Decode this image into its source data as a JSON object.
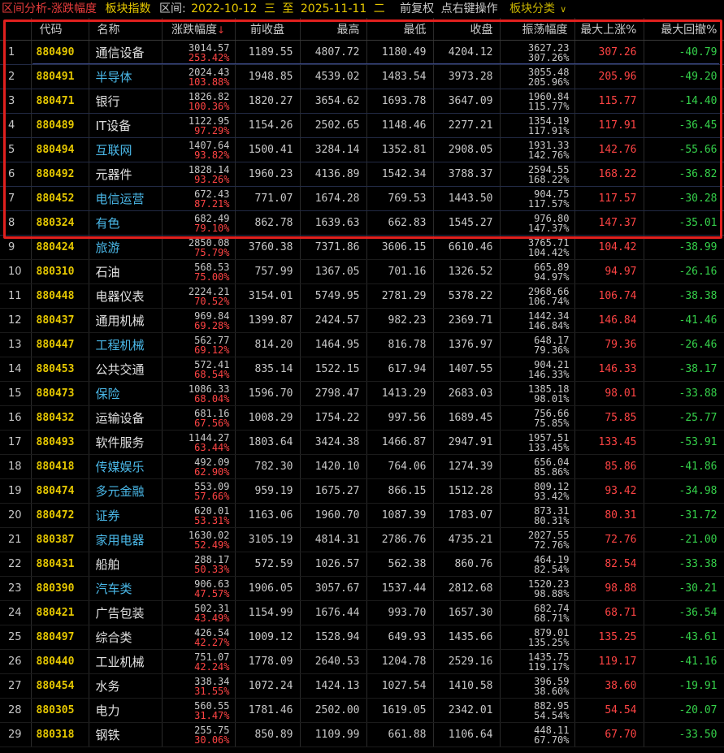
{
  "title": {
    "part1": "区间分析",
    "part2": "-涨跌幅度",
    "part3": "板块指数",
    "range_label": "区间:",
    "start_date": "2022-10-12",
    "start_weekday": "三",
    "to": "至",
    "end_date": "2025-11-11",
    "end_weekday": "二",
    "adjust": "前复权",
    "hint": "点右键操作",
    "category": "板块分类",
    "category_arrow": "∨"
  },
  "headers": {
    "idx": "",
    "code": "代码",
    "name": "名称",
    "change": "涨跌幅度",
    "sort_arrow": "↓",
    "prev_close": "前收盘",
    "high": "最高",
    "low": "最低",
    "close": "收盘",
    "amplitude": "振荡幅度",
    "max_up": "最大上涨%",
    "max_drawdown": "最大回撤%"
  },
  "rows": [
    {
      "idx": "1",
      "code": "880490",
      "name": "通信设备",
      "name_color": "white",
      "chg_abs": "3014.57",
      "chg_pct": "253.42%",
      "prev": "1189.55",
      "high": "4807.72",
      "low": "1180.49",
      "close": "4204.12",
      "amp_abs": "3627.23",
      "amp_pct": "307.26%",
      "max_up": "307.26",
      "max_dd": "-40.79"
    },
    {
      "idx": "2",
      "code": "880491",
      "name": "半导体",
      "name_color": "cyan",
      "chg_abs": "2024.43",
      "chg_pct": "103.88%",
      "prev": "1948.85",
      "high": "4539.02",
      "low": "1483.54",
      "close": "3973.28",
      "amp_abs": "3055.48",
      "amp_pct": "205.96%",
      "max_up": "205.96",
      "max_dd": "-49.20"
    },
    {
      "idx": "3",
      "code": "880471",
      "name": "银行",
      "name_color": "white",
      "chg_abs": "1826.82",
      "chg_pct": "100.36%",
      "prev": "1820.27",
      "high": "3654.62",
      "low": "1693.78",
      "close": "3647.09",
      "amp_abs": "1960.84",
      "amp_pct": "115.77%",
      "max_up": "115.77",
      "max_dd": "-14.40"
    },
    {
      "idx": "4",
      "code": "880489",
      "name": "IT设备",
      "name_color": "white",
      "chg_abs": "1122.95",
      "chg_pct": "97.29%",
      "prev": "1154.26",
      "high": "2502.65",
      "low": "1148.46",
      "close": "2277.21",
      "amp_abs": "1354.19",
      "amp_pct": "117.91%",
      "max_up": "117.91",
      "max_dd": "-36.45"
    },
    {
      "idx": "5",
      "code": "880494",
      "name": "互联网",
      "name_color": "cyan",
      "chg_abs": "1407.64",
      "chg_pct": "93.82%",
      "prev": "1500.41",
      "high": "3284.14",
      "low": "1352.81",
      "close": "2908.05",
      "amp_abs": "1931.33",
      "amp_pct": "142.76%",
      "max_up": "142.76",
      "max_dd": "-55.66"
    },
    {
      "idx": "6",
      "code": "880492",
      "name": "元器件",
      "name_color": "white",
      "chg_abs": "1828.14",
      "chg_pct": "93.26%",
      "prev": "1960.23",
      "high": "4136.89",
      "low": "1542.34",
      "close": "3788.37",
      "amp_abs": "2594.55",
      "amp_pct": "168.22%",
      "max_up": "168.22",
      "max_dd": "-36.82"
    },
    {
      "idx": "7",
      "code": "880452",
      "name": "电信运营",
      "name_color": "cyan",
      "chg_abs": "672.43",
      "chg_pct": "87.21%",
      "prev": "771.07",
      "high": "1674.28",
      "low": "769.53",
      "close": "1443.50",
      "amp_abs": "904.75",
      "amp_pct": "117.57%",
      "max_up": "117.57",
      "max_dd": "-30.28"
    },
    {
      "idx": "8",
      "code": "880324",
      "name": "有色",
      "name_color": "cyan",
      "chg_abs": "682.49",
      "chg_pct": "79.10%",
      "prev": "862.78",
      "high": "1639.63",
      "low": "662.83",
      "close": "1545.27",
      "amp_abs": "976.80",
      "amp_pct": "147.37%",
      "max_up": "147.37",
      "max_dd": "-35.01"
    },
    {
      "idx": "9",
      "code": "880424",
      "name": "旅游",
      "name_color": "cyan",
      "chg_abs": "2850.08",
      "chg_pct": "75.79%",
      "prev": "3760.38",
      "high": "7371.86",
      "low": "3606.15",
      "close": "6610.46",
      "amp_abs": "3765.71",
      "amp_pct": "104.42%",
      "max_up": "104.42",
      "max_dd": "-38.99"
    },
    {
      "idx": "10",
      "code": "880310",
      "name": "石油",
      "name_color": "white",
      "chg_abs": "568.53",
      "chg_pct": "75.00%",
      "prev": "757.99",
      "high": "1367.05",
      "low": "701.16",
      "close": "1326.52",
      "amp_abs": "665.89",
      "amp_pct": "94.97%",
      "max_up": "94.97",
      "max_dd": "-26.16"
    },
    {
      "idx": "11",
      "code": "880448",
      "name": "电器仪表",
      "name_color": "white",
      "chg_abs": "2224.21",
      "chg_pct": "70.52%",
      "prev": "3154.01",
      "high": "5749.95",
      "low": "2781.29",
      "close": "5378.22",
      "amp_abs": "2968.66",
      "amp_pct": "106.74%",
      "max_up": "106.74",
      "max_dd": "-38.38"
    },
    {
      "idx": "12",
      "code": "880437",
      "name": "通用机械",
      "name_color": "white",
      "chg_abs": "969.84",
      "chg_pct": "69.28%",
      "prev": "1399.87",
      "high": "2424.57",
      "low": "982.23",
      "close": "2369.71",
      "amp_abs": "1442.34",
      "amp_pct": "146.84%",
      "max_up": "146.84",
      "max_dd": "-41.46"
    },
    {
      "idx": "13",
      "code": "880447",
      "name": "工程机械",
      "name_color": "cyan",
      "chg_abs": "562.77",
      "chg_pct": "69.12%",
      "prev": "814.20",
      "high": "1464.95",
      "low": "816.78",
      "close": "1376.97",
      "amp_abs": "648.17",
      "amp_pct": "79.36%",
      "max_up": "79.36",
      "max_dd": "-26.46"
    },
    {
      "idx": "14",
      "code": "880453",
      "name": "公共交通",
      "name_color": "white",
      "chg_abs": "572.41",
      "chg_pct": "68.54%",
      "prev": "835.14",
      "high": "1522.15",
      "low": "617.94",
      "close": "1407.55",
      "amp_abs": "904.21",
      "amp_pct": "146.33%",
      "max_up": "146.33",
      "max_dd": "-38.17"
    },
    {
      "idx": "15",
      "code": "880473",
      "name": "保险",
      "name_color": "cyan",
      "chg_abs": "1086.33",
      "chg_pct": "68.04%",
      "prev": "1596.70",
      "high": "2798.47",
      "low": "1413.29",
      "close": "2683.03",
      "amp_abs": "1385.18",
      "amp_pct": "98.01%",
      "max_up": "98.01",
      "max_dd": "-33.88"
    },
    {
      "idx": "16",
      "code": "880432",
      "name": "运输设备",
      "name_color": "white",
      "chg_abs": "681.16",
      "chg_pct": "67.56%",
      "prev": "1008.29",
      "high": "1754.22",
      "low": "997.56",
      "close": "1689.45",
      "amp_abs": "756.66",
      "amp_pct": "75.85%",
      "max_up": "75.85",
      "max_dd": "-25.77"
    },
    {
      "idx": "17",
      "code": "880493",
      "name": "软件服务",
      "name_color": "white",
      "chg_abs": "1144.27",
      "chg_pct": "63.44%",
      "prev": "1803.64",
      "high": "3424.38",
      "low": "1466.87",
      "close": "2947.91",
      "amp_abs": "1957.51",
      "amp_pct": "133.45%",
      "max_up": "133.45",
      "max_dd": "-53.91"
    },
    {
      "idx": "18",
      "code": "880418",
      "name": "传媒娱乐",
      "name_color": "cyan",
      "chg_abs": "492.09",
      "chg_pct": "62.90%",
      "prev": "782.30",
      "high": "1420.10",
      "low": "764.06",
      "close": "1274.39",
      "amp_abs": "656.04",
      "amp_pct": "85.86%",
      "max_up": "85.86",
      "max_dd": "-41.86"
    },
    {
      "idx": "19",
      "code": "880474",
      "name": "多元金融",
      "name_color": "cyan",
      "chg_abs": "553.09",
      "chg_pct": "57.66%",
      "prev": "959.19",
      "high": "1675.27",
      "low": "866.15",
      "close": "1512.28",
      "amp_abs": "809.12",
      "amp_pct": "93.42%",
      "max_up": "93.42",
      "max_dd": "-34.98"
    },
    {
      "idx": "20",
      "code": "880472",
      "name": "证券",
      "name_color": "cyan",
      "chg_abs": "620.01",
      "chg_pct": "53.31%",
      "prev": "1163.06",
      "high": "1960.70",
      "low": "1087.39",
      "close": "1783.07",
      "amp_abs": "873.31",
      "amp_pct": "80.31%",
      "max_up": "80.31",
      "max_dd": "-31.72"
    },
    {
      "idx": "21",
      "code": "880387",
      "name": "家用电器",
      "name_color": "cyan",
      "chg_abs": "1630.02",
      "chg_pct": "52.49%",
      "prev": "3105.19",
      "high": "4814.31",
      "low": "2786.76",
      "close": "4735.21",
      "amp_abs": "2027.55",
      "amp_pct": "72.76%",
      "max_up": "72.76",
      "max_dd": "-21.00"
    },
    {
      "idx": "22",
      "code": "880431",
      "name": "船舶",
      "name_color": "white",
      "chg_abs": "288.17",
      "chg_pct": "50.33%",
      "prev": "572.59",
      "high": "1026.57",
      "low": "562.38",
      "close": "860.76",
      "amp_abs": "464.19",
      "amp_pct": "82.54%",
      "max_up": "82.54",
      "max_dd": "-33.38"
    },
    {
      "idx": "23",
      "code": "880390",
      "name": "汽车类",
      "name_color": "cyan",
      "chg_abs": "906.63",
      "chg_pct": "47.57%",
      "prev": "1906.05",
      "high": "3057.67",
      "low": "1537.44",
      "close": "2812.68",
      "amp_abs": "1520.23",
      "amp_pct": "98.88%",
      "max_up": "98.88",
      "max_dd": "-30.21"
    },
    {
      "idx": "24",
      "code": "880421",
      "name": "广告包装",
      "name_color": "white",
      "chg_abs": "502.31",
      "chg_pct": "43.49%",
      "prev": "1154.99",
      "high": "1676.44",
      "low": "993.70",
      "close": "1657.30",
      "amp_abs": "682.74",
      "amp_pct": "68.71%",
      "max_up": "68.71",
      "max_dd": "-36.54"
    },
    {
      "idx": "25",
      "code": "880497",
      "name": "综合类",
      "name_color": "white",
      "chg_abs": "426.54",
      "chg_pct": "42.27%",
      "prev": "1009.12",
      "high": "1528.94",
      "low": "649.93",
      "close": "1435.66",
      "amp_abs": "879.01",
      "amp_pct": "135.25%",
      "max_up": "135.25",
      "max_dd": "-43.61"
    },
    {
      "idx": "26",
      "code": "880440",
      "name": "工业机械",
      "name_color": "white",
      "chg_abs": "751.07",
      "chg_pct": "42.24%",
      "prev": "1778.09",
      "high": "2640.53",
      "low": "1204.78",
      "close": "2529.16",
      "amp_abs": "1435.75",
      "amp_pct": "119.17%",
      "max_up": "119.17",
      "max_dd": "-41.16"
    },
    {
      "idx": "27",
      "code": "880454",
      "name": "水务",
      "name_color": "white",
      "chg_abs": "338.34",
      "chg_pct": "31.55%",
      "prev": "1072.24",
      "high": "1424.13",
      "low": "1027.54",
      "close": "1410.58",
      "amp_abs": "396.59",
      "amp_pct": "38.60%",
      "max_up": "38.60",
      "max_dd": "-19.91"
    },
    {
      "idx": "28",
      "code": "880305",
      "name": "电力",
      "name_color": "white",
      "chg_abs": "560.55",
      "chg_pct": "31.47%",
      "prev": "1781.46",
      "high": "2502.00",
      "low": "1619.05",
      "close": "2342.01",
      "amp_abs": "882.95",
      "amp_pct": "54.54%",
      "max_up": "54.54",
      "max_dd": "-20.07"
    },
    {
      "idx": "29",
      "code": "880318",
      "name": "钢铁",
      "name_color": "white",
      "chg_abs": "255.75",
      "chg_pct": "30.06%",
      "prev": "850.89",
      "high": "1109.99",
      "low": "661.88",
      "close": "1106.64",
      "amp_abs": "448.11",
      "amp_pct": "67.70%",
      "max_up": "67.70",
      "max_dd": "-33.50"
    }
  ],
  "colors": {
    "background": "#000000",
    "up_red": "#ff4444",
    "down_green": "#35d04a",
    "code_yellow": "#e6c800",
    "name_cyan": "#4ab8e8",
    "highlight_border": "#e0201e"
  }
}
